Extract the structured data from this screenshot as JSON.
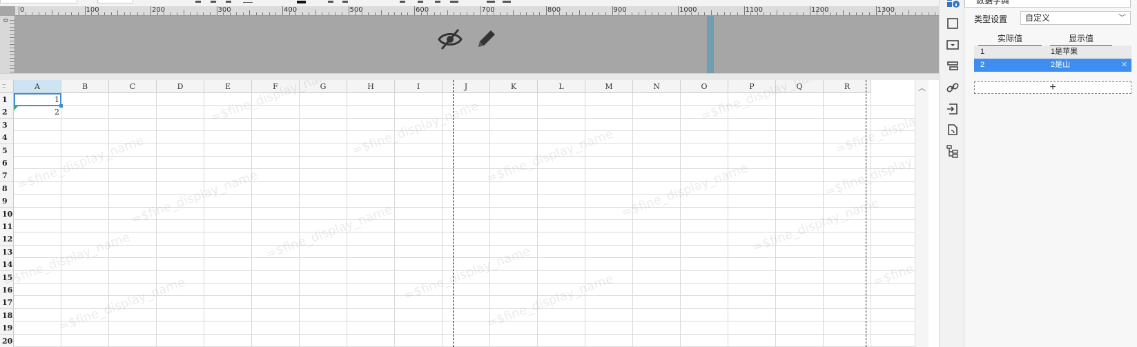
{
  "ruler": {
    "labels": [
      "0",
      "100",
      "200",
      "300",
      "400",
      "500",
      "600",
      "700",
      "800",
      "900",
      "1000",
      "1100",
      "1200",
      "1300"
    ],
    "left_label": "0"
  },
  "header_area": {
    "icons": [
      "eye-slash-icon",
      "pencil-icon"
    ]
  },
  "sheet": {
    "columns": [
      "A",
      "B",
      "C",
      "D",
      "E",
      "F",
      "G",
      "H",
      "I",
      "J",
      "K",
      "L",
      "M",
      "N",
      "O",
      "P",
      "Q",
      "R"
    ],
    "rows": [
      "1",
      "2",
      "3",
      "4",
      "5",
      "6",
      "7",
      "8",
      "9",
      "10",
      "11",
      "12",
      "13",
      "14",
      "15",
      "16",
      "17",
      "18",
      "19",
      "20"
    ],
    "cells": {
      "A1": "1",
      "A2": "2"
    },
    "selected_cell": "A1",
    "watermark": "=$fine_display_name"
  },
  "properties": {
    "data_dictionary_label": "数据字典",
    "type_label": "类型设置",
    "type_value": "自定义",
    "table": {
      "headers": [
        "实际值",
        "显示值"
      ],
      "rows": [
        {
          "actual": "1",
          "display": "1是苹果"
        },
        {
          "actual": "2",
          "display": "2是山"
        }
      ],
      "active_row": 1,
      "add_label": "+"
    }
  },
  "colors": {
    "accent": "#3d8ef0",
    "selection_border": "#3f8fd8",
    "page_boundary": "#6f9fae",
    "header_bg": "#a6a6a6"
  }
}
